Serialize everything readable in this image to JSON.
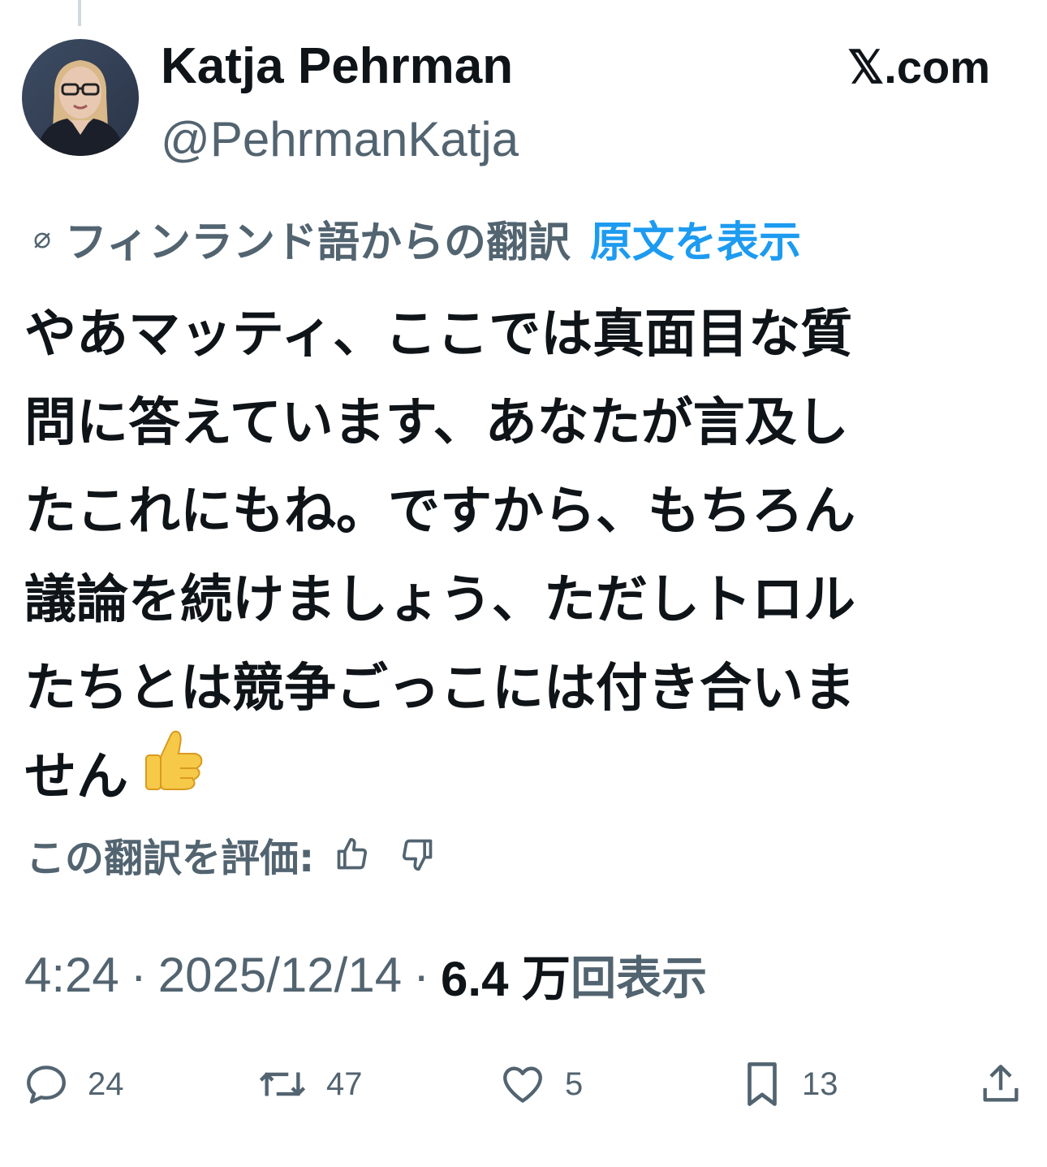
{
  "author": {
    "display_name": "Katja Pehrman",
    "handle": "@PehrmanKatja"
  },
  "brand": "𝕏.com",
  "translation": {
    "icon": "translate-icon",
    "label": "フィンランド語からの翻訳",
    "show_original": "原文を表示"
  },
  "tweet": {
    "lines": [
      "やあマッティ、ここでは真面目な質",
      "問に答えています、あなたが言及し",
      "たこれにもね。ですから、もちろん",
      "議論を続けましょう、ただしトロル",
      "たちとは競争ごっこには付き合いま",
      "せん"
    ],
    "emoji": "thumbs-up-emoji"
  },
  "rating": {
    "label": "この翻訳を評価:",
    "up_icon": "thumbs-up-icon",
    "down_icon": "thumbs-down-icon"
  },
  "meta": {
    "time": "4:24",
    "date": "2025/12/14",
    "separator": "·",
    "views_count": "6.4 万",
    "views_label": "回表示"
  },
  "actions": {
    "replies": "24",
    "reposts": "47",
    "likes": "5",
    "bookmarks": "13"
  },
  "colors": {
    "text": "#0f1419",
    "secondary": "#536471",
    "link": "#1d9bf0"
  }
}
